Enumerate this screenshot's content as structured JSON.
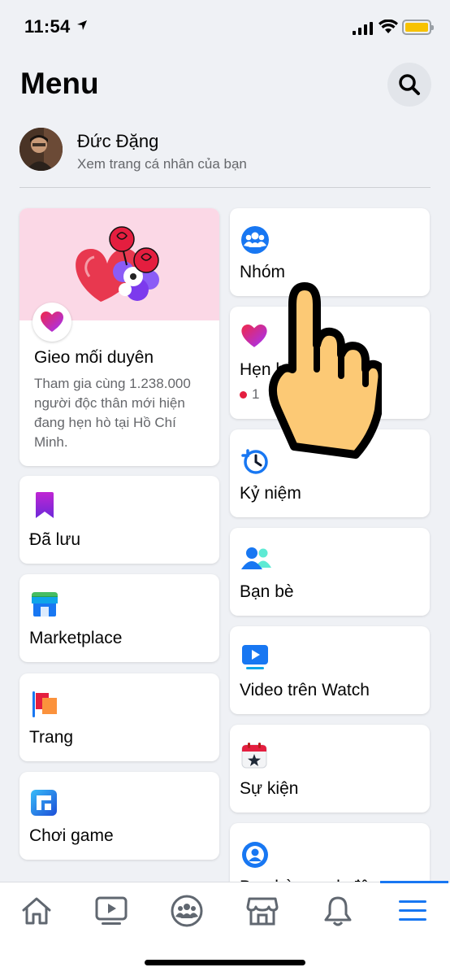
{
  "status": {
    "time": "11:54"
  },
  "header": {
    "title": "Menu"
  },
  "profile": {
    "name": "Đức Đặng",
    "subtitle": "Xem trang cá nhân của bạn"
  },
  "dating": {
    "title": "Gieo mối duyên",
    "description": "Tham gia cùng 1.238.000 người độc thân mới hiện đang hẹn hò tại Hồ Chí Minh."
  },
  "left_items": [
    {
      "label": "Đã lưu",
      "icon": "bookmark-icon"
    },
    {
      "label": "Marketplace",
      "icon": "marketplace-icon"
    },
    {
      "label": "Trang",
      "icon": "flag-icon"
    },
    {
      "label": "Chơi game",
      "icon": "gaming-icon"
    }
  ],
  "right_items": [
    {
      "label": "Nhóm",
      "icon": "groups-icon"
    },
    {
      "label": "Hẹn hò",
      "icon": "dating-heart-icon",
      "sub": "1"
    },
    {
      "label": "Kỷ niệm",
      "icon": "memories-icon"
    },
    {
      "label": "Bạn bè",
      "icon": "friends-icon"
    },
    {
      "label": "Video trên Watch",
      "icon": "watch-icon"
    },
    {
      "label": "Sự kiện",
      "icon": "events-icon"
    },
    {
      "label": "Bạn bè quanh đây",
      "icon": "nearby-friends-icon"
    }
  ],
  "tabbar": {
    "tabs": [
      "home-icon",
      "watch-tab-icon",
      "groups-tab-icon",
      "marketplace-tab-icon",
      "notifications-icon",
      "menu-icon"
    ],
    "active": "menu-icon"
  },
  "colors": {
    "accent": "#1877f2",
    "background": "#eff1f5",
    "dating_pink": "#fbd8e6"
  }
}
